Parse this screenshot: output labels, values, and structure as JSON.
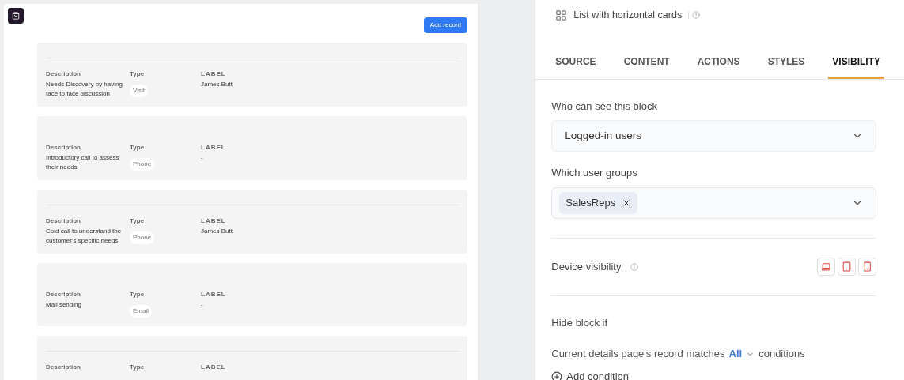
{
  "canvas": {
    "add_button": "Add record",
    "cards": [
      {
        "divider": true,
        "description_label": "Description",
        "description": "Needs Discovery by having face to face discussion",
        "type_label": "Type",
        "type": "Visit",
        "label_label": "LABEL",
        "label": "James Butt"
      },
      {
        "divider": false,
        "description_label": "Description",
        "description": "Introductory call to assess their needs",
        "type_label": "Type",
        "type": "Phone",
        "label_label": "LABEL",
        "label": "-"
      },
      {
        "divider": true,
        "description_label": "Description",
        "description": "Cold call to understand the customer's specific needs",
        "type_label": "Type",
        "type": "Phone",
        "label_label": "LABEL",
        "label": "James Butt"
      },
      {
        "divider": false,
        "description_label": "Description",
        "description": "Mail sending",
        "type_label": "Type",
        "type": "Email",
        "label_label": "LABEL",
        "label": "-"
      },
      {
        "divider": true,
        "description_label": "Description",
        "type_label": "Type",
        "label_label": "LABEL"
      }
    ]
  },
  "panel": {
    "subtitle": "List with horizontal cards",
    "tabs": [
      {
        "label": "SOURCE",
        "selected": false
      },
      {
        "label": "CONTENT",
        "selected": false
      },
      {
        "label": "ACTIONS",
        "selected": false
      },
      {
        "label": "STYLES",
        "selected": false
      },
      {
        "label": "VISIBILITY",
        "selected": true
      }
    ],
    "who_label": "Who can see this block",
    "who_value": "Logged-in users",
    "groups_label": "Which user groups",
    "groups": [
      "SalesReps"
    ],
    "device_label": "Device visibility",
    "hide_label": "Hide block if",
    "condition": {
      "before": "Current details page's record matches",
      "match": "All",
      "after": "conditions"
    },
    "add_condition": "Add condition"
  }
}
